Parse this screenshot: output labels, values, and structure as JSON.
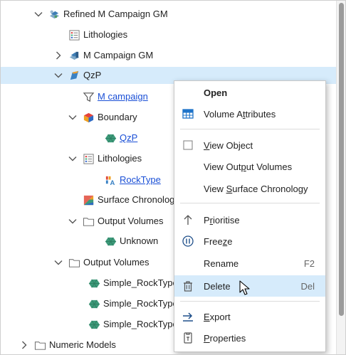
{
  "tree": {
    "rows": [
      {
        "label": "Refined M Campaign GM"
      },
      {
        "label": "Lithologies"
      },
      {
        "label": "M Campaign GM"
      },
      {
        "label": "QzP"
      },
      {
        "label": "M campaign"
      },
      {
        "label": "Boundary"
      },
      {
        "label": "QzP"
      },
      {
        "label": "Lithologies"
      },
      {
        "label": "RockType"
      },
      {
        "label": "Surface Chronology"
      },
      {
        "label": "Output Volumes"
      },
      {
        "label": "Unknown"
      },
      {
        "label": "Output Volumes"
      },
      {
        "label": "Simple_RockType"
      },
      {
        "label": "Simple_RockType"
      },
      {
        "label": "Simple_RockType"
      },
      {
        "label": "Numeric Models"
      }
    ]
  },
  "menu": {
    "open": "Open",
    "volume_attributes": {
      "pre": "Volume A",
      "u": "t",
      "post": "tributes"
    },
    "view_object": {
      "pre": "",
      "u": "V",
      "post": "iew Object"
    },
    "view_output_volumes": {
      "pre": "View Out",
      "u": "p",
      "post": "ut Volumes"
    },
    "view_surface_chronology": {
      "pre": "View ",
      "u": "S",
      "post": "urface Chronology"
    },
    "prioritise": {
      "pre": "P",
      "u": "r",
      "post": "ioritise"
    },
    "freeze": {
      "pre": "Free",
      "u": "z",
      "post": "e"
    },
    "rename": "Rename",
    "rename_key": "F2",
    "delete": "Delete",
    "delete_key": "Del",
    "export": {
      "pre": "",
      "u": "E",
      "post": "xport"
    },
    "properties": {
      "pre": "",
      "u": "P",
      "post": "roperties"
    }
  },
  "colors": {
    "selection": "#d6ebfb",
    "link": "#1a4fd6",
    "accent_blue": "#1f74c9"
  }
}
